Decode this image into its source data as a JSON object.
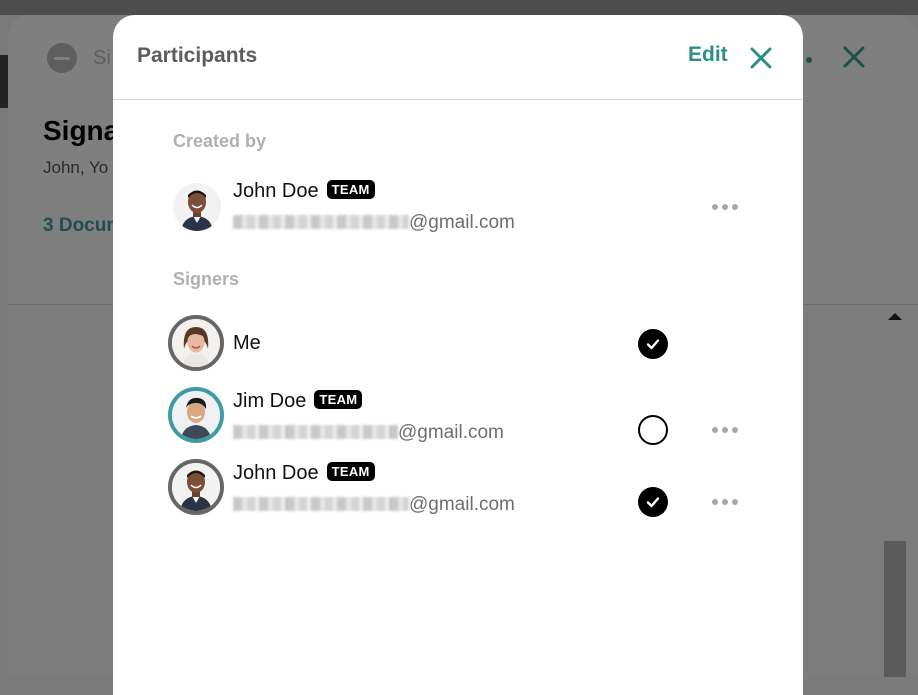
{
  "background": {
    "status_text": "Si",
    "title": "Signa",
    "subtitle": "John, Yo",
    "documents_link": "3 Docum"
  },
  "modal": {
    "title": "Participants",
    "edit_label": "Edit",
    "close_icon": "close-icon"
  },
  "created_by": {
    "label": "Created by",
    "person": {
      "name": "John Doe",
      "badge": "TEAM",
      "email_suffix": "@gmail.com",
      "more_icon": "more-horizontal-icon"
    }
  },
  "signers": {
    "label": "Signers",
    "items": [
      {
        "name": "Me",
        "badge": "",
        "email_suffix": "",
        "status": "signed",
        "status_icon": "check-circle-icon"
      },
      {
        "name": "Jim Doe",
        "badge": "TEAM",
        "email_suffix": "@gmail.com",
        "status": "pending",
        "status_icon": "empty-circle-icon",
        "more_icon": "more-horizontal-icon"
      },
      {
        "name": "John Doe",
        "badge": "TEAM",
        "email_suffix": "@gmail.com",
        "status": "signed",
        "status_icon": "check-circle-icon",
        "more_icon": "more-horizontal-icon"
      }
    ]
  },
  "colors": {
    "accent": "#2e8d89",
    "teal_ring": "#3e9aa3",
    "overlay": "#7f7f7f"
  }
}
